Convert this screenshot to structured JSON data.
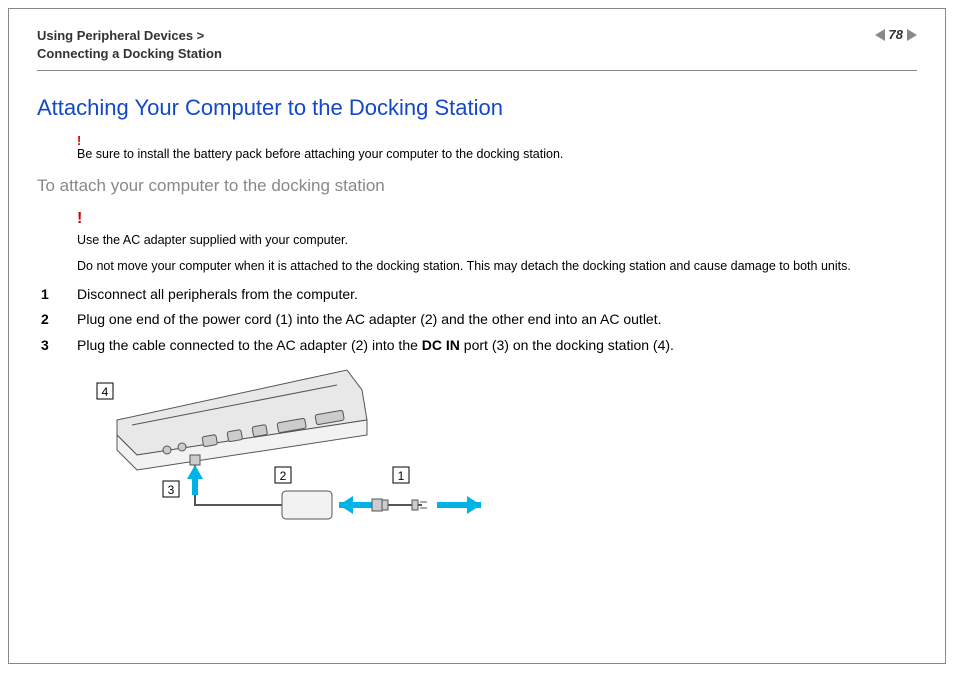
{
  "header": {
    "breadcrumb_line1": "Using Peripheral Devices >",
    "breadcrumb_line2": "Connecting a Docking Station",
    "page_number": "78"
  },
  "title": "Attaching Your Computer to the Docking Station",
  "note1": {
    "bang": "!",
    "text": "Be sure to install the battery pack before attaching your computer to the docking station."
  },
  "subtitle": "To attach your computer to the docking station",
  "warn": {
    "bang": "!",
    "line1": "Use the AC adapter supplied with your computer.",
    "line2": "Do not move your computer when it is attached to the docking station. This may detach the docking station and cause damage to both units."
  },
  "steps": [
    "Disconnect all peripherals from the computer.",
    "Plug one end of the power cord (1) into the AC adapter (2) and the other end into an AC outlet.",
    "Plug the cable connected to the AC adapter (2) into the DC IN port (3) on the docking station (4)."
  ],
  "step3_parts": {
    "pre": "Plug the cable connected to the AC adapter (2) into the ",
    "bold": "DC IN",
    "post": " port (3) on the docking station (4)."
  },
  "callouts": {
    "c1": "1",
    "c2": "2",
    "c3": "3",
    "c4": "4"
  }
}
